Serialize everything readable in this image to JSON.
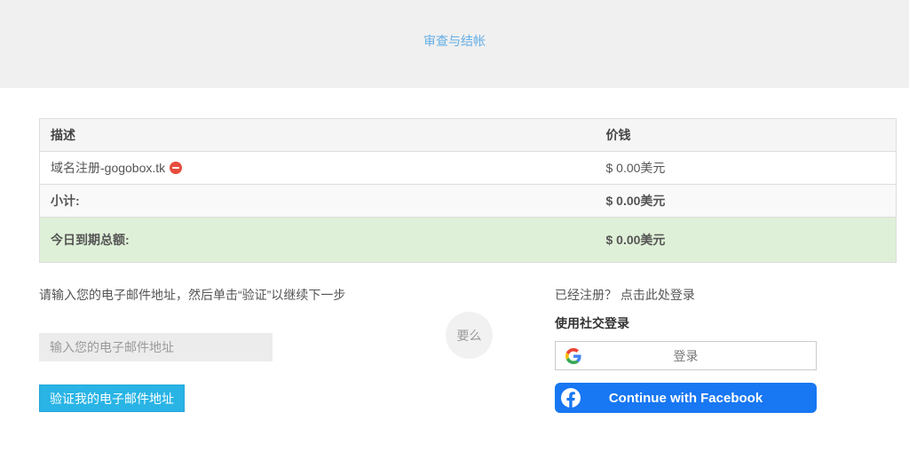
{
  "topbar": {
    "review_link": "审查与结帐"
  },
  "table": {
    "headers": [
      "描述",
      "价钱"
    ],
    "rows": [
      {
        "label": "域名注册-gogobox.tk",
        "price": "$ 0.00美元"
      },
      {
        "label": "小计:",
        "price": "$ 0.00美元"
      },
      {
        "label": "今日到期总额:",
        "price": "$ 0.00美元"
      }
    ]
  },
  "email_section": {
    "instruction": "请输入您的电子邮件地址，然后单击“验证”以继续下一步",
    "email_placeholder": "输入您的电子邮件地址",
    "verify_button": "验证我的电子邮件地址"
  },
  "divider": {
    "or_label": "要么"
  },
  "login_section": {
    "already_registered": "已经注册？ 点击此处登录",
    "social_login_title": "使用社交登录",
    "google_button": "登录",
    "facebook_button": "Continue with Facebook"
  },
  "colors": {
    "accent_blue": "#29b4e5",
    "link_blue": "#62aee6",
    "facebook_blue": "#1877f2",
    "highlight_green": "#dff0d8",
    "remove_red": "#e74c3c",
    "topbar_gray": "#f0f0f0"
  }
}
